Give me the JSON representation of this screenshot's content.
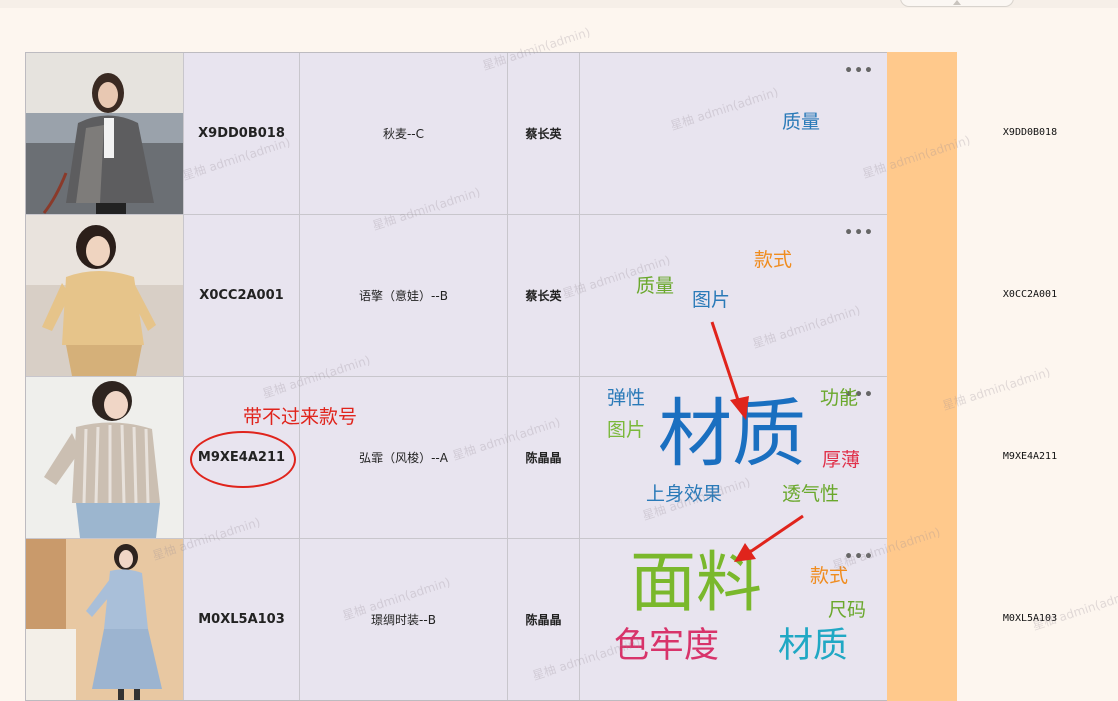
{
  "rows": [
    {
      "code": "X9DD0B018",
      "name": "秋麦--C",
      "person": "蔡长英",
      "more": "•••",
      "right_code": "X9DD0B018",
      "words": [
        "质量"
      ]
    },
    {
      "code": "X0CC2A001",
      "name": "语擎（意娃）--B",
      "person": "蔡长英",
      "more": "•••",
      "right_code": "X0CC2A001",
      "words": [
        "款式",
        "质量",
        "图片"
      ]
    },
    {
      "code": "M9XE4A211",
      "name": "弘霏（风梭）--A",
      "person": "陈晶晶",
      "more": "•••",
      "right_code": "M9XE4A211",
      "words": [
        "弹性",
        "功能",
        "图片",
        "材质",
        "厚薄",
        "上身效果",
        "透气性"
      ]
    },
    {
      "code": "M0XL5A103",
      "name": "璟绸时装--B",
      "person": "陈晶晶",
      "more": "•••",
      "right_code": "M0XL5A103",
      "words": [
        "面料",
        "款式",
        "尺码",
        "色牢度",
        "材质"
      ]
    }
  ],
  "annotation": {
    "text": "带不过来款号"
  },
  "watermark": "星柚 admin(admin)",
  "colors": {
    "accent_red": "#e0241c",
    "orange": "#ffc98c",
    "table_bg": "#e8e4ef"
  }
}
